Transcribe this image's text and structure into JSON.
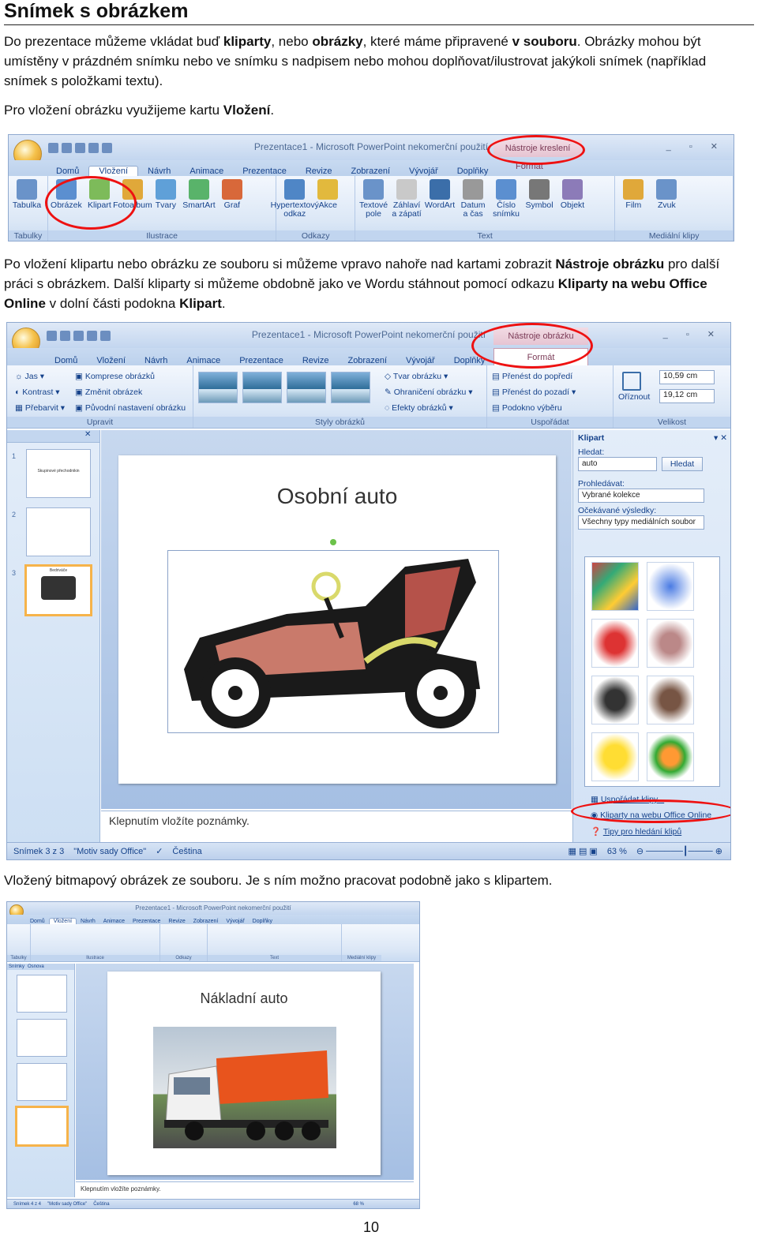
{
  "doc": {
    "title": "Snímek s obrázkem",
    "p1": {
      "t1": "Do prezentace můžeme vkládat buď ",
      "b1": "kliparty",
      "t2": ", nebo ",
      "b2": "obrázky",
      "t3": ", které máme připravené ",
      "b3": "v souboru",
      "t4": ". Obrázky mohou být umístěny v prázdném snímku nebo ve snímku s nadpisem nebo mohou doplňovat/ilustrovat jakýkoli snímek (například snímek s položkami textu)."
    },
    "p2": {
      "t1": "Pro vložení obrázku využijeme kartu ",
      "b1": "Vložení",
      "t2": "."
    },
    "p3": {
      "t1": "Po vložení klipartu nebo obrázku ze souboru si můžeme vpravo nahoře nad kartami zobrazit ",
      "b1": "Nástroje obrázku",
      "t2": " pro další práci s obrázkem. Další kliparty si můžeme obdobně jako ve Wordu stáhnout pomocí odkazu ",
      "b2": "Kliparty na webu Office Online",
      "t3": " v dolní části podokna ",
      "b3": "Klipart",
      "t4": "."
    },
    "p4": "Vložený bitmapový obrázek ze souboru. Je s ním možno pracovat podobně jako s klipartem.",
    "page_number": "10"
  },
  "shot1": {
    "window_title": "Prezentace1 - Microsoft PowerPoint nekomerční použití",
    "context_tab": "Nástroje kreslení",
    "context_subtab": "Formát",
    "tabs": [
      "Domů",
      "Vložení",
      "Návrh",
      "Animace",
      "Prezentace",
      "Revize",
      "Zobrazení",
      "Vývojář",
      "Doplňky"
    ],
    "groups": [
      {
        "label": "Tabulky",
        "buttons": [
          "Tabulka"
        ]
      },
      {
        "label": "Ilustrace",
        "buttons": [
          "Obrázek",
          "Klipart",
          "Fotoalbum",
          "Tvary",
          "SmartArt",
          "Graf"
        ]
      },
      {
        "label": "Odkazy",
        "buttons": [
          "Hypertextový odkaz",
          "Akce"
        ]
      },
      {
        "label": "Text",
        "buttons": [
          "Textové pole",
          "Záhlaví a zápatí",
          "WordArt",
          "Datum a čas",
          "Číslo snímku",
          "Symbol",
          "Objekt"
        ]
      },
      {
        "label": "Mediální klipy",
        "buttons": [
          "Film",
          "Zvuk"
        ]
      }
    ]
  },
  "shot2": {
    "window_title": "Prezentace1 - Microsoft PowerPoint nekomerční použití",
    "context_tab": "Nástroje obrázku",
    "context_subtab": "Formát",
    "tabs": [
      "Domů",
      "Vložení",
      "Návrh",
      "Animace",
      "Prezentace",
      "Revize",
      "Zobrazení",
      "Vývojář",
      "Doplňky"
    ],
    "upravit": {
      "jas": "Jas",
      "kontrast": "Kontrast",
      "prebarvit": "Přebarvit",
      "komprese": "Komprese obrázků",
      "zmenit": "Změnit obrázek",
      "puvodni": "Původní nastavení obrázku",
      "label": "Upravit"
    },
    "styly_label": "Styly obrázků",
    "styly_opts": {
      "tvar": "Tvar obrázku",
      "ohraniceni": "Ohraničení obrázku",
      "efekty": "Efekty obrázků"
    },
    "usporadat": {
      "dopredu": "Přenést do popředí",
      "dozadu": "Přenést do pozadí",
      "podokno": "Podokno výběru",
      "label": "Uspořádat"
    },
    "velikost": {
      "oriznout": "Oříznout",
      "height": "10,59 cm",
      "width": "19,12 cm",
      "label": "Velikost"
    },
    "slide_title": "Osobní auto",
    "thumb1": "Skupinové přechodnikin",
    "thumb3": "Bedriváče",
    "notes": "Klepnutím vložíte poznámky.",
    "taskpane": {
      "title": "Klipart",
      "hledat_label": "Hledat:",
      "hledat_value": "auto",
      "hledat_button": "Hledat",
      "prohledavat_label": "Prohledávat:",
      "prohledavat_value": "Vybrané kolekce",
      "ocekavane_label": "Očekávané výsledky:",
      "ocekavane_value": "Všechny typy mediálních soubor",
      "usporadat": "Uspořádat klipy...",
      "online": "Kliparty na webu Office Online",
      "tipy": "Tipy pro hledání klipů"
    },
    "status": {
      "slide": "Snímek 3 z 3",
      "theme": "\"Motiv sady Office\"",
      "lang": "Čeština",
      "zoom": "63 %"
    }
  },
  "shot3": {
    "window_title": "Prezentace1 - Microsoft PowerPoint nekomerční použití",
    "tabs": [
      "Domů",
      "Vložení",
      "Návrh",
      "Animace",
      "Prezentace",
      "Revize",
      "Zobrazení",
      "Vývojář",
      "Doplňky"
    ],
    "groups": [
      "Tabulky",
      "Ilustrace",
      "Odkazy",
      "Text",
      "Mediální klipy"
    ],
    "panel_tabs": [
      "Snímky",
      "Osnova"
    ],
    "slide_title": "Nákladní auto",
    "notes": "Klepnutím vložíte poznámky.",
    "status": {
      "slide": "Snímek 4 z 4",
      "theme": "\"Motiv sady Office\"",
      "lang": "Čeština",
      "zoom": "68 %"
    }
  },
  "colors": {
    "ribbon_blue": "#15428b",
    "highlight_red": "#ee1111",
    "context_pink": "#e6c4d2"
  }
}
